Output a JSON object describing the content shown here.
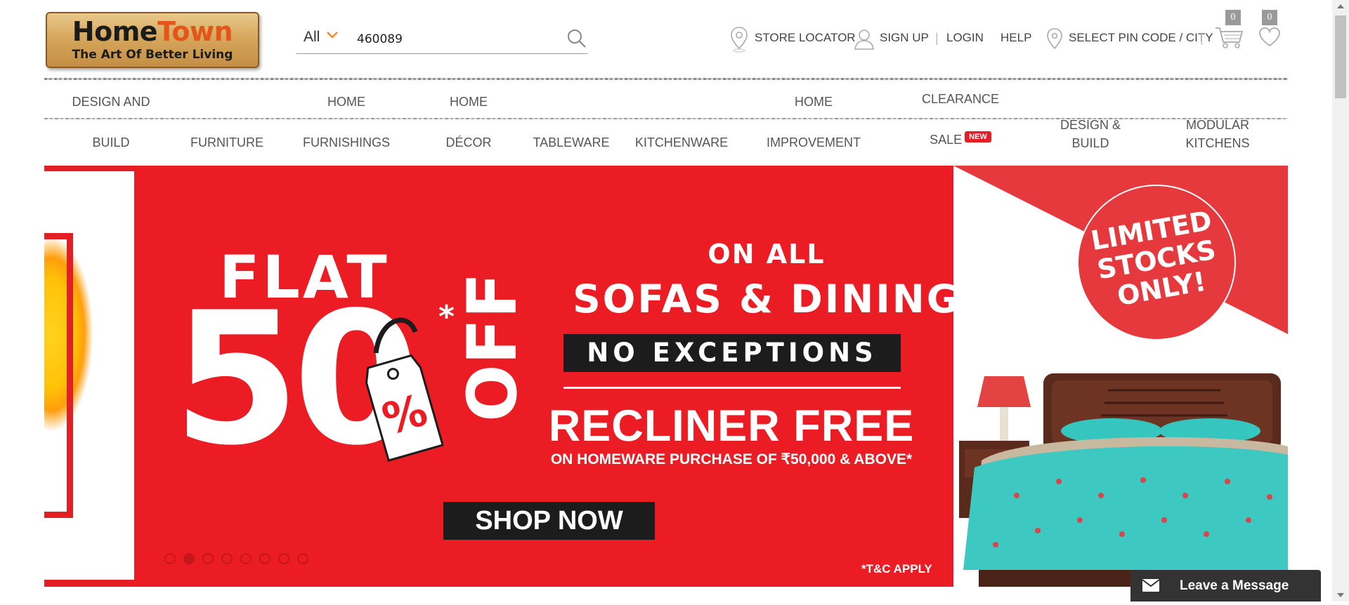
{
  "logo": {
    "brand_part1": "Home",
    "brand_part2": "Town",
    "tagline": "The Art Of Better Living"
  },
  "search": {
    "category": "All",
    "value": "460089",
    "icon": "search-icon"
  },
  "top_links": {
    "store_locator": "STORE LOCATOR",
    "sign_up": "SIGN UP",
    "login": "LOGIN",
    "help": "HELP",
    "pin_code": "SELECT PIN CODE / CITY",
    "separator": "|"
  },
  "cart": {
    "count": "0",
    "icon": "cart-icon"
  },
  "wishlist": {
    "count": "0",
    "icon": "heart-icon"
  },
  "category_nav": {
    "design_build_1a": "DESIGN AND",
    "design_build_1b": "BUILD",
    "furniture": "FURNITURE",
    "furnishings_a": "HOME",
    "furnishings_b": "FURNISHINGS",
    "decor_a": "HOME",
    "decor_b": "DÉCOR",
    "tableware": "TABLEWARE",
    "kitchenware": "KITCHENWARE",
    "improvement_a": "HOME",
    "improvement_b": "IMPROVEMENT",
    "clearance_a": "CLEARANCE",
    "clearance_b": "SALE",
    "new_badge": "NEW",
    "design_build_2a": "DESIGN &",
    "design_build_2b": "BUILD",
    "modular_a": "MODULAR",
    "modular_b": "KITCHENS"
  },
  "banner": {
    "flat": "FLAT",
    "fifty": "50",
    "percent": "%",
    "off": "OFF",
    "asterisk": "*",
    "on_all": "ON ALL",
    "sofas_dining": "SOFAS & DINING",
    "no_exceptions": "NO EXCEPTIONS",
    "recliner_free": "RECLINER FREE",
    "homeware_offer": "ON HOMEWARE PURCHASE OF ₹50,000 & ABOVE*",
    "shop_now": "SHOP NOW",
    "tc_apply": "*T&C APPLY",
    "limited_stocks": "LIMITED STOCKS ONLY!",
    "slide_count": 8,
    "active_slide": 2
  },
  "chat": {
    "label": "Leave a Message",
    "icon": "envelope-icon"
  },
  "colors": {
    "brand_red": "#ec1c24",
    "dark": "#1c1c1c",
    "accent_orange": "#f08a24"
  }
}
